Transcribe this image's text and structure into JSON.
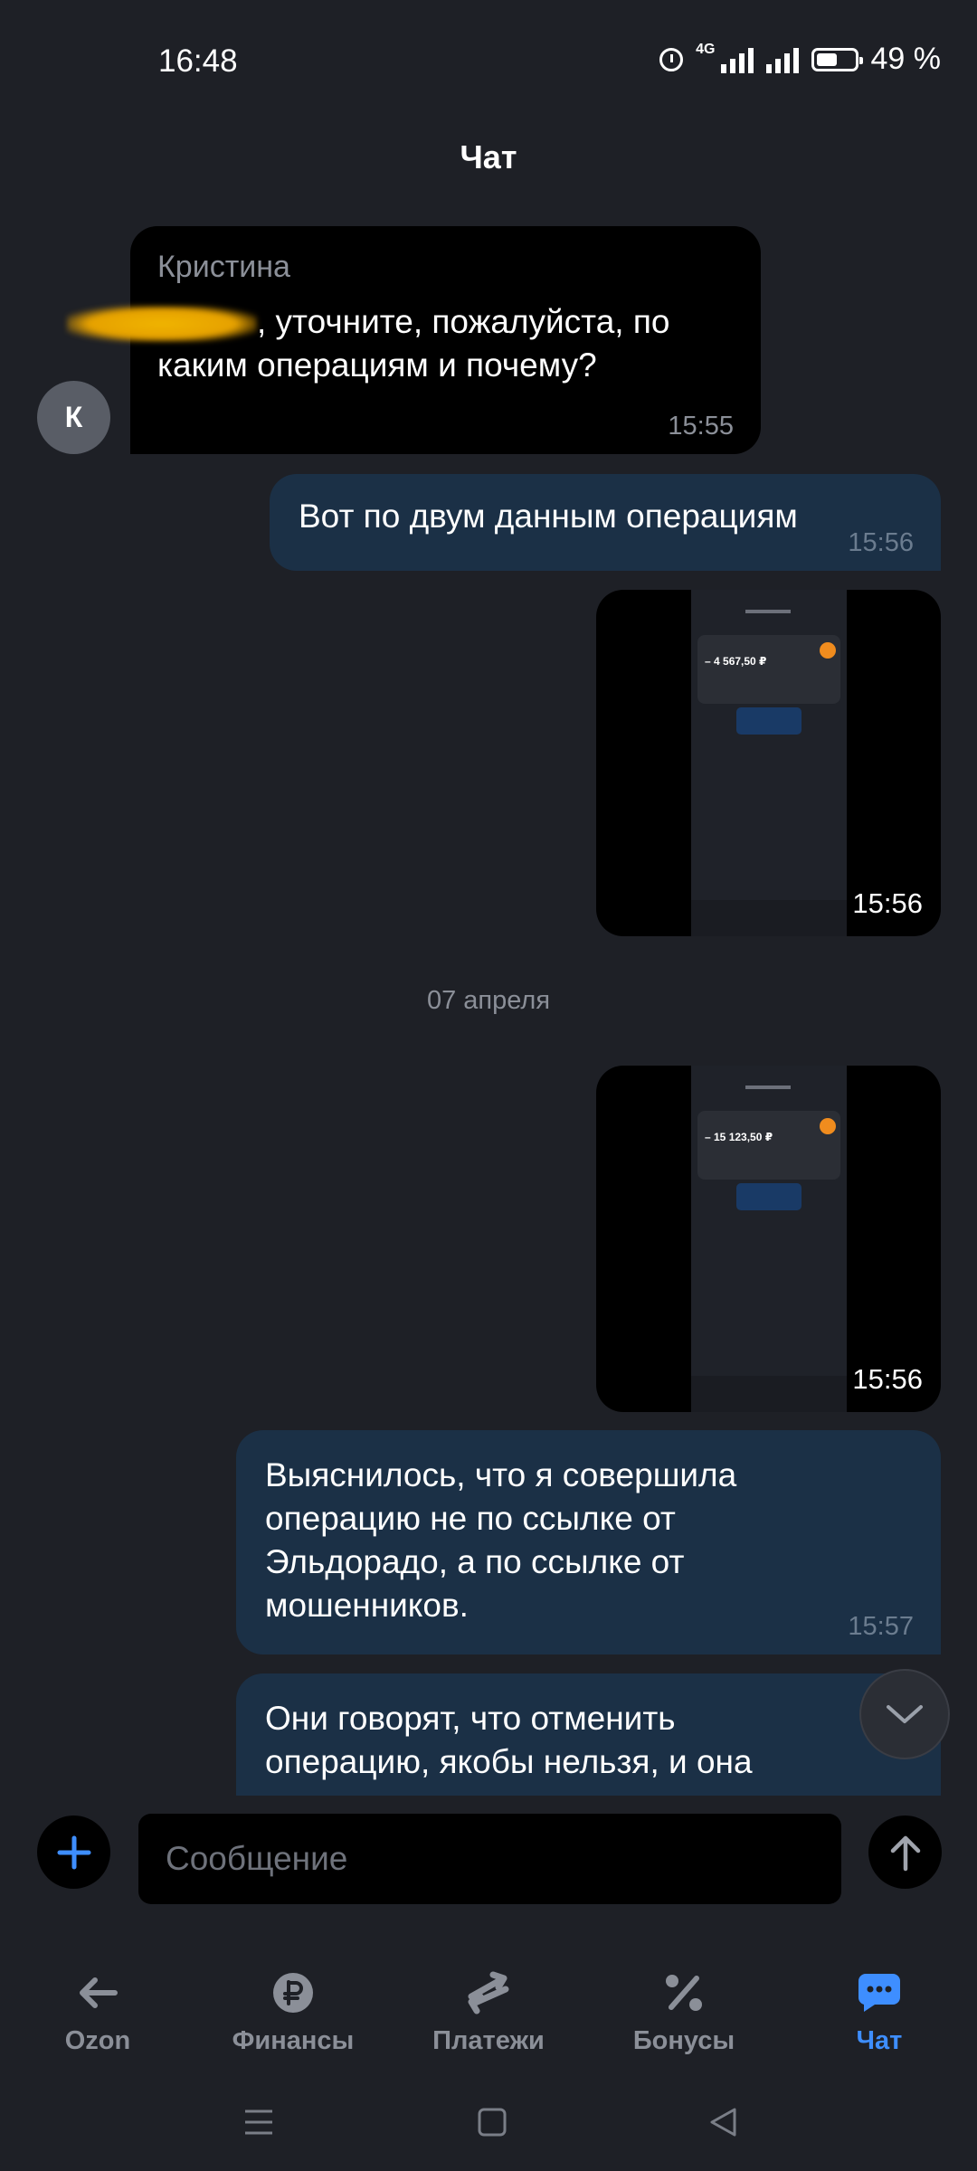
{
  "status_bar": {
    "time": "16:48",
    "network": "4G",
    "battery": "49 %",
    "battery_level": 0.49
  },
  "header": {
    "title": "Чат"
  },
  "messages": {
    "incoming": {
      "sender": "Кристина",
      "text": ", уточните, пожалуйста, по каким операциям и почему?",
      "time": "15:55",
      "avatar_letter": "К"
    },
    "out1": {
      "text": "Вот по двум данным операциям",
      "time": "15:56"
    },
    "photo1": {
      "amount": "– 4 567,50 ₽",
      "time": "15:56"
    },
    "date_separator": "07 апреля",
    "photo2": {
      "amount": "– 15 123,50 ₽",
      "time": "15:56"
    },
    "out2": {
      "text": "Выяснилось, что я совершила операцию не по ссылке от Эльдорадо, а по ссылке от мошенников.",
      "time": "15:57"
    },
    "out3": {
      "text": "Они говорят, что отменить операцию, якобы нельзя, и она"
    }
  },
  "composer": {
    "placeholder": "Сообщение"
  },
  "tabs": [
    {
      "label": "Ozon",
      "icon": "arrow-left-icon"
    },
    {
      "label": "Финансы",
      "icon": "ruble-icon"
    },
    {
      "label": "Платежи",
      "icon": "transfer-arrows-icon"
    },
    {
      "label": "Бонусы",
      "icon": "percent-icon"
    },
    {
      "label": "Чат",
      "icon": "chat-bubble-icon",
      "active": true
    }
  ],
  "colors": {
    "background": "#1e2026",
    "outgoing_bubble": "#1b3046",
    "incoming_bubble": "#000000",
    "accent": "#3e8eff"
  }
}
